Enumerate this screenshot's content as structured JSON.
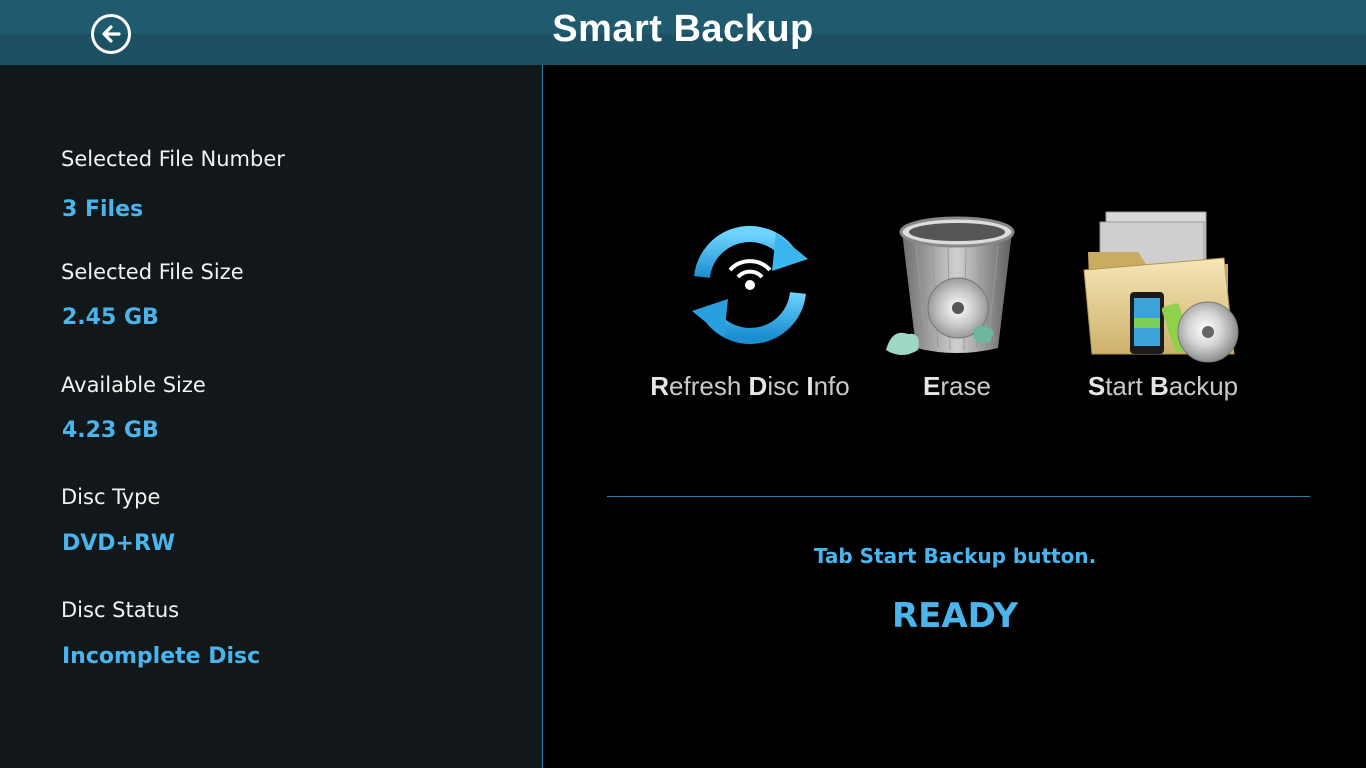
{
  "header": {
    "title": "Smart Backup",
    "back_icon": "back-arrow-icon"
  },
  "info": {
    "selected_file_number": {
      "label": "Selected File Number",
      "value": "3 Files"
    },
    "selected_file_size": {
      "label": "Selected File Size",
      "value": "2.45 GB"
    },
    "available_size": {
      "label": "Available Size",
      "value": "4.23 GB"
    },
    "disc_type": {
      "label": "Disc Type",
      "value": "DVD+RW"
    },
    "disc_status": {
      "label": "Disc Status",
      "value": "Incomplete Disc"
    }
  },
  "actions": {
    "refresh": {
      "initials": [
        "R",
        "D",
        "I"
      ],
      "rest": [
        "efresh ",
        "isc ",
        "nfo"
      ],
      "icon": "refresh-wifi-icon"
    },
    "erase": {
      "initials": [
        "E"
      ],
      "rest": [
        "rase"
      ],
      "icon": "trash-bin-disc-icon"
    },
    "start_backup": {
      "initials": [
        "S",
        "B"
      ],
      "rest": [
        "tart ",
        "ackup"
      ],
      "icon": "folder-backup-icon"
    }
  },
  "status": {
    "hint": "Tab Start Backup button.",
    "state": "READY"
  },
  "colors": {
    "header": "#1d5063",
    "accent": "#4ab4ec",
    "left_panel": "#121719",
    "divider": "#2f7fa3"
  }
}
